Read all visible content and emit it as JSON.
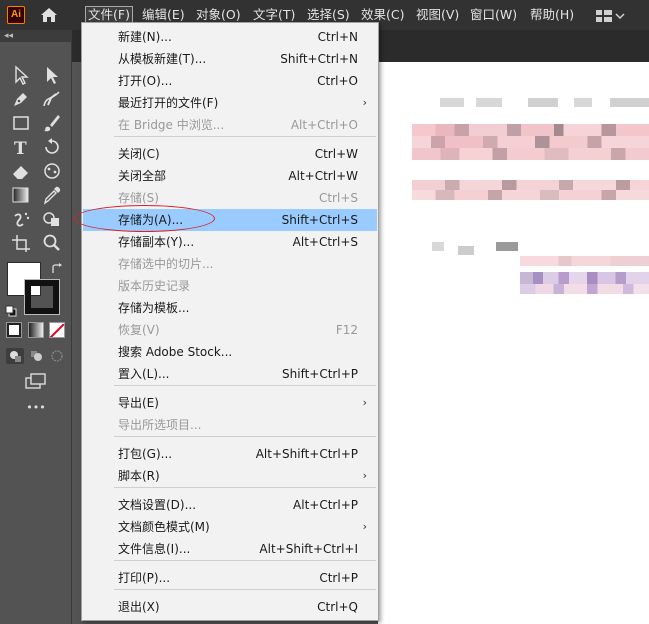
{
  "app": {
    "logo_text": "Ai"
  },
  "menubar": {
    "items": [
      {
        "label": "文件(F)"
      },
      {
        "label": "编辑(E)"
      },
      {
        "label": "对象(O)"
      },
      {
        "label": "文字(T)"
      },
      {
        "label": "选择(S)"
      },
      {
        "label": "效果(C)"
      },
      {
        "label": "视图(V)"
      },
      {
        "label": "窗口(W)"
      },
      {
        "label": "帮助(H)"
      }
    ],
    "active_index": 0
  },
  "toolbar": {
    "collapse_label": "◂◂",
    "more_label": "•••"
  },
  "file_menu": {
    "items": [
      {
        "label": "新建(N)...",
        "shortcut": "Ctrl+N",
        "enabled": true
      },
      {
        "label": "从模板新建(T)...",
        "shortcut": "Shift+Ctrl+N",
        "enabled": true
      },
      {
        "label": "打开(O)...",
        "shortcut": "Ctrl+O",
        "enabled": true
      },
      {
        "label": "最近打开的文件(F)",
        "shortcut": "",
        "enabled": true,
        "submenu": true
      },
      {
        "label": "在 Bridge 中浏览...",
        "shortcut": "Alt+Ctrl+O",
        "enabled": false
      },
      {
        "label": "关闭(C)",
        "shortcut": "Ctrl+W",
        "enabled": true
      },
      {
        "label": "关闭全部",
        "shortcut": "Alt+Ctrl+W",
        "enabled": true
      },
      {
        "label": "存储(S)",
        "shortcut": "Ctrl+S",
        "enabled": false
      },
      {
        "label": "存储为(A)...",
        "shortcut": "Shift+Ctrl+S",
        "enabled": true,
        "highlighted": true
      },
      {
        "label": "存储副本(Y)...",
        "shortcut": "Alt+Ctrl+S",
        "enabled": true
      },
      {
        "label": "存储选中的切片...",
        "shortcut": "",
        "enabled": false
      },
      {
        "label": "版本历史记录",
        "shortcut": "",
        "enabled": false
      },
      {
        "label": "存储为模板...",
        "shortcut": "",
        "enabled": true
      },
      {
        "label": "恢复(V)",
        "shortcut": "F12",
        "enabled": false
      },
      {
        "label": "搜索 Adobe Stock...",
        "shortcut": "",
        "enabled": true
      },
      {
        "label": "置入(L)...",
        "shortcut": "Shift+Ctrl+P",
        "enabled": true
      },
      {
        "label": "导出(E)",
        "shortcut": "",
        "enabled": true,
        "submenu": true
      },
      {
        "label": "导出所选项目...",
        "shortcut": "",
        "enabled": false
      },
      {
        "label": "打包(G)...",
        "shortcut": "Alt+Shift+Ctrl+P",
        "enabled": true
      },
      {
        "label": "脚本(R)",
        "shortcut": "",
        "enabled": true,
        "submenu": true
      },
      {
        "label": "文档设置(D)...",
        "shortcut": "Alt+Ctrl+P",
        "enabled": true
      },
      {
        "label": "文档颜色模式(M)",
        "shortcut": "",
        "enabled": true,
        "submenu": true
      },
      {
        "label": "文件信息(I)...",
        "shortcut": "Alt+Shift+Ctrl+I",
        "enabled": true
      },
      {
        "label": "打印(P)...",
        "shortcut": "Ctrl+P",
        "enabled": true
      },
      {
        "label": "退出(X)",
        "shortcut": "Ctrl+Q",
        "enabled": true
      }
    ],
    "submenu_arrow": "›"
  },
  "colors": {
    "highlight": "#99cbff",
    "annotation": "#d8222a",
    "menubar_bg": "#323232",
    "panel_bg": "#535353"
  }
}
